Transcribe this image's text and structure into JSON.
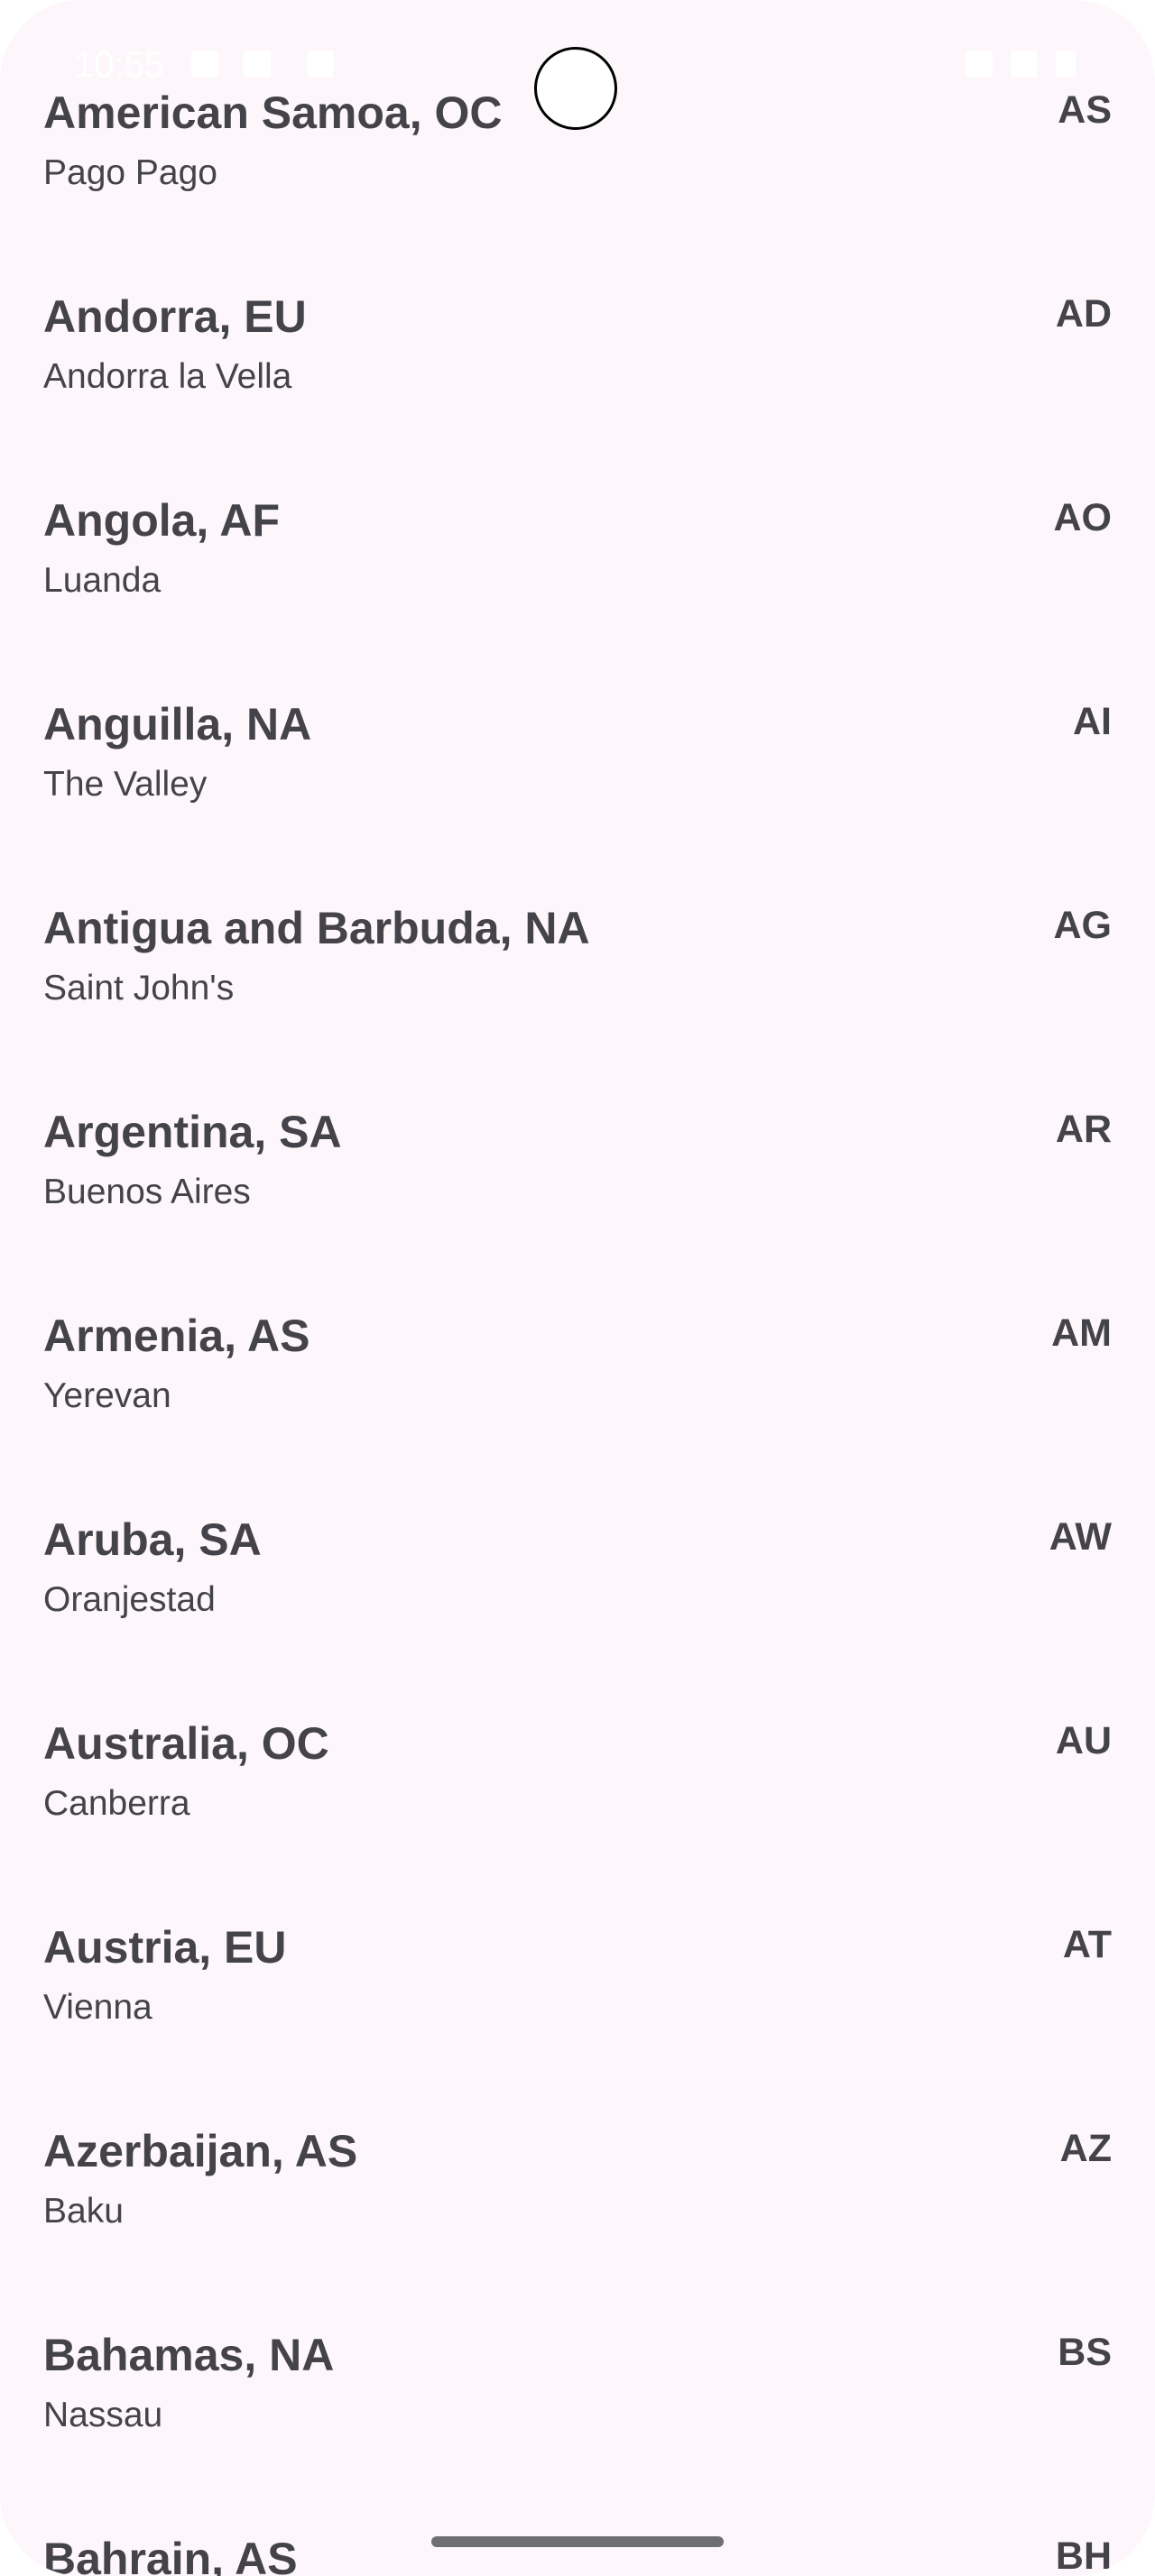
{
  "status_bar": {
    "time": "10:55"
  },
  "countries": [
    {
      "name": "American Samoa, OC",
      "capital": "Pago Pago",
      "code": "AS"
    },
    {
      "name": "Andorra, EU",
      "capital": "Andorra la Vella",
      "code": "AD"
    },
    {
      "name": "Angola, AF",
      "capital": "Luanda",
      "code": "AO"
    },
    {
      "name": "Anguilla, NA",
      "capital": "The Valley",
      "code": "AI"
    },
    {
      "name": "Antigua and Barbuda, NA",
      "capital": "Saint John's",
      "code": "AG"
    },
    {
      "name": "Argentina, SA",
      "capital": "Buenos Aires",
      "code": "AR"
    },
    {
      "name": "Armenia, AS",
      "capital": "Yerevan",
      "code": "AM"
    },
    {
      "name": "Aruba, SA",
      "capital": "Oranjestad",
      "code": "AW"
    },
    {
      "name": "Australia, OC",
      "capital": "Canberra",
      "code": "AU"
    },
    {
      "name": "Austria, EU",
      "capital": "Vienna",
      "code": "AT"
    },
    {
      "name": "Azerbaijan, AS",
      "capital": "Baku",
      "code": "AZ"
    },
    {
      "name": "Bahamas, NA",
      "capital": "Nassau",
      "code": "BS"
    },
    {
      "name": "Bahrain, AS",
      "capital": "",
      "code": "BH"
    }
  ]
}
